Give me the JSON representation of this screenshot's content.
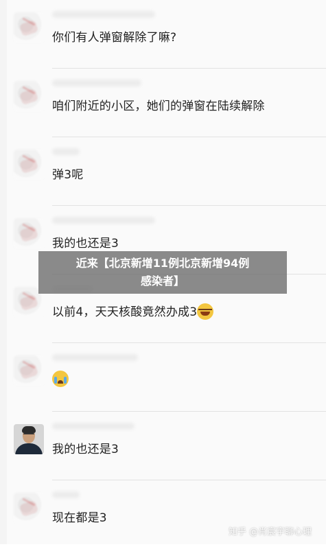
{
  "messages": [
    {
      "text": "你们有人弹窗解除了嘛?"
    },
    {
      "text": "咱们附近的小区，她们的弹窗在陆续解除"
    },
    {
      "text": "弹3呢"
    },
    {
      "text": "我的也还是3"
    },
    {
      "text": "以前4，天天核酸竟然办成3"
    },
    {
      "text": ""
    },
    {
      "text": "我的也还是3"
    },
    {
      "text": "现在都是3"
    }
  ],
  "overlay": {
    "title_line1": "近来【北京新增11例北京新增94例",
    "title_line2": "感染者】"
  },
  "watermark": "知乎 @肖宸宇聊心理",
  "emojis": {
    "message5": "laughing-crying-emoji",
    "message6": "crying-emoji"
  },
  "colors": {
    "background": "#fafafa",
    "text": "#222222",
    "overlay": "#6e6e6e"
  }
}
